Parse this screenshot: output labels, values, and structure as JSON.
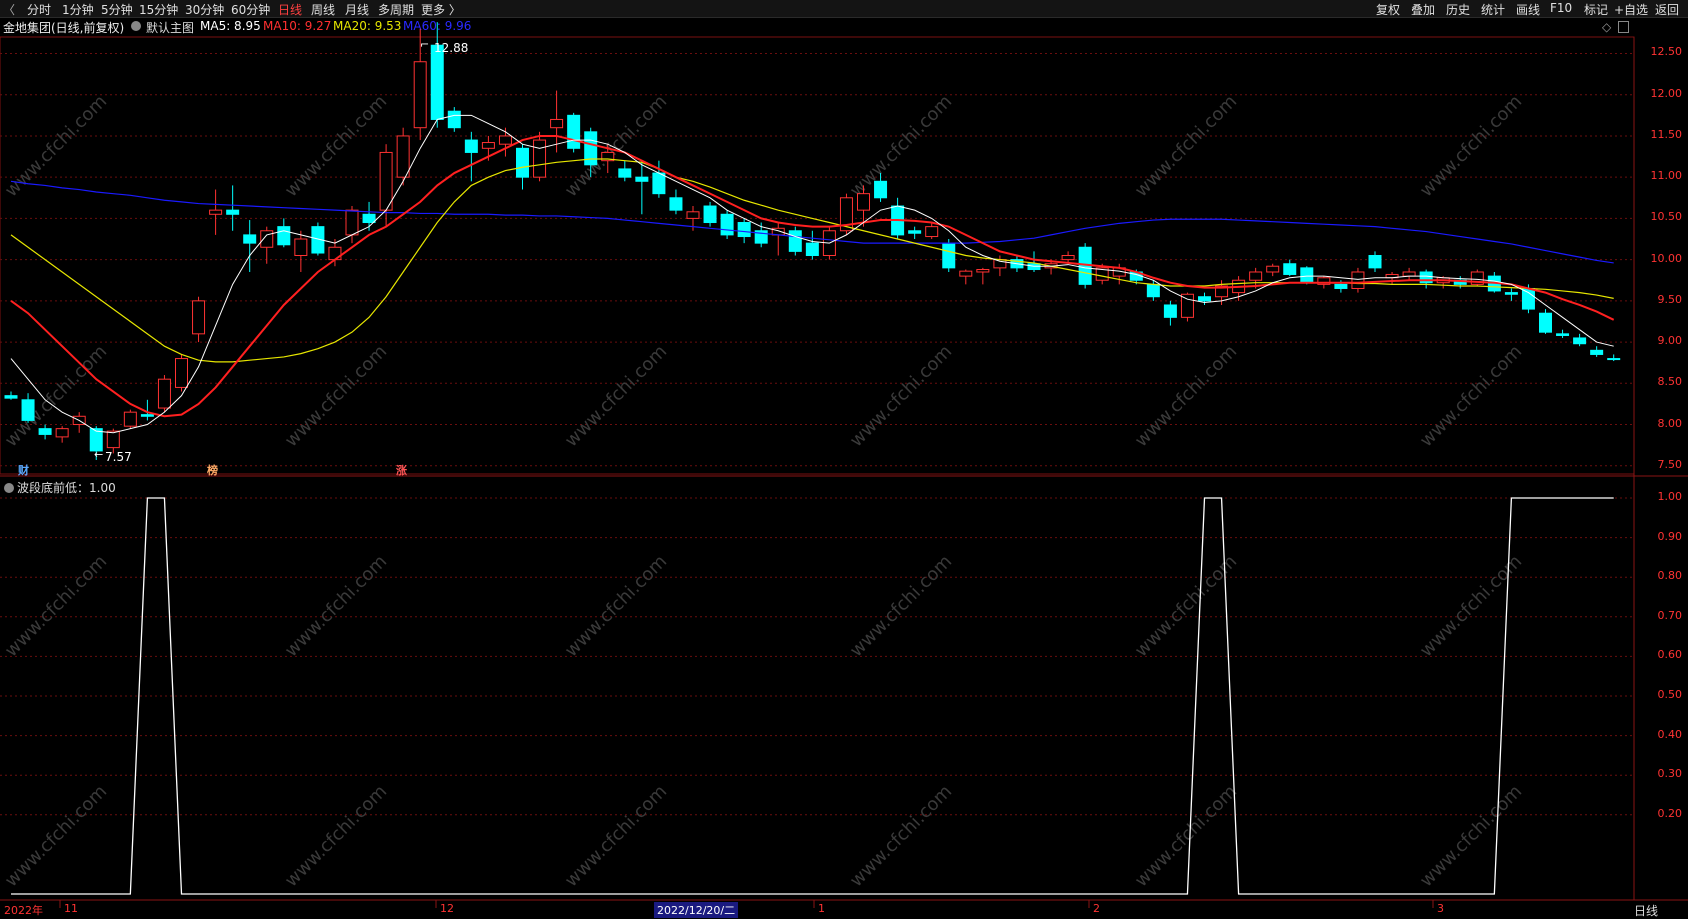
{
  "toolbar": {
    "left_items": [
      "分时",
      "1分钟",
      "5分钟",
      "15分钟",
      "30分钟",
      "60分钟",
      "日线",
      "周线",
      "月线",
      "多周期",
      "更多 〉"
    ],
    "active": "日线",
    "right_items": [
      "复权",
      "叠加",
      "历史",
      "统计",
      "画线",
      "F10",
      "标记",
      "+自选",
      "返回"
    ]
  },
  "info": {
    "stock": "金地集团(日线,前复权)",
    "template": "默认主图",
    "ma5": "MA5: 8.95",
    "ma10": "MA10: 9.27",
    "ma20": "MA20: 9.53",
    "ma60": "MA60: 9.96"
  },
  "main_ticks": [
    "12.50",
    "12.00",
    "11.50",
    "11.00",
    "10.50",
    "10.00",
    "9.50",
    "9.00",
    "8.50",
    "8.00",
    "7.50"
  ],
  "sub_ticks": [
    "1.00",
    "0.90",
    "0.80",
    "0.70",
    "0.60",
    "0.50",
    "0.40",
    "0.30",
    "0.20"
  ],
  "annotations": {
    "high": "12.88",
    "low": "7.57"
  },
  "signals": {
    "cai": "财",
    "bang": "榜",
    "zhang": "涨"
  },
  "sub_panel": {
    "label": "波段底前低：1.00"
  },
  "x_labels": [
    "2022年",
    "11",
    "12",
    "1",
    "2",
    "3"
  ],
  "cursor_date": "2022/12/20/二",
  "period_label": "日线",
  "watermark": "www.cfchi.com",
  "colors": {
    "up": "#ff3232",
    "down": "#00ffff",
    "ma5": "#ffffff",
    "ma10": "#ff2020",
    "ma20": "#e6e600",
    "ma60": "#1a1aff"
  },
  "chart_data": {
    "type": "candlestick",
    "ylim": [
      7.4,
      12.7
    ],
    "candles": [
      [
        8.35,
        8.4,
        8.3,
        8.32
      ],
      [
        8.3,
        8.38,
        8.02,
        8.05
      ],
      [
        7.95,
        8.0,
        7.82,
        7.88
      ],
      [
        7.85,
        7.98,
        7.78,
        7.95
      ],
      [
        8.0,
        8.15,
        7.9,
        8.1
      ],
      [
        7.95,
        7.98,
        7.57,
        7.68
      ],
      [
        7.72,
        7.95,
        7.65,
        7.92
      ],
      [
        7.98,
        8.18,
        7.95,
        8.15
      ],
      [
        8.12,
        8.3,
        8.05,
        8.1
      ],
      [
        8.2,
        8.6,
        8.15,
        8.55
      ],
      [
        8.45,
        8.85,
        8.4,
        8.8
      ],
      [
        9.1,
        9.55,
        9.0,
        9.5
      ],
      [
        10.55,
        10.85,
        10.3,
        10.6
      ],
      [
        10.6,
        10.9,
        10.35,
        10.55
      ],
      [
        10.3,
        10.48,
        9.85,
        10.2
      ],
      [
        10.15,
        10.4,
        9.95,
        10.35
      ],
      [
        10.4,
        10.5,
        10.15,
        10.18
      ],
      [
        10.05,
        10.35,
        9.85,
        10.25
      ],
      [
        10.4,
        10.45,
        10.05,
        10.08
      ],
      [
        10.0,
        10.25,
        9.92,
        10.15
      ],
      [
        10.3,
        10.65,
        10.2,
        10.6
      ],
      [
        10.55,
        10.7,
        10.35,
        10.45
      ],
      [
        10.6,
        11.4,
        10.4,
        11.3
      ],
      [
        11.0,
        11.6,
        10.9,
        11.5
      ],
      [
        11.6,
        12.8,
        11.45,
        12.4
      ],
      [
        12.6,
        12.88,
        11.6,
        11.7
      ],
      [
        11.8,
        11.85,
        11.55,
        11.6
      ],
      [
        11.45,
        11.55,
        10.95,
        11.3
      ],
      [
        11.35,
        11.5,
        11.2,
        11.42
      ],
      [
        11.4,
        11.6,
        11.25,
        11.5
      ],
      [
        11.35,
        11.4,
        10.85,
        11.0
      ],
      [
        11.0,
        11.55,
        10.95,
        11.45
      ],
      [
        11.6,
        12.05,
        11.3,
        11.7
      ],
      [
        11.75,
        11.78,
        11.3,
        11.35
      ],
      [
        11.55,
        11.6,
        11.0,
        11.15
      ],
      [
        11.2,
        11.4,
        11.05,
        11.3
      ],
      [
        11.1,
        11.2,
        10.95,
        11.0
      ],
      [
        11.0,
        11.2,
        10.55,
        10.95
      ],
      [
        11.05,
        11.2,
        10.75,
        10.8
      ],
      [
        10.75,
        10.85,
        10.55,
        10.6
      ],
      [
        10.5,
        10.65,
        10.35,
        10.58
      ],
      [
        10.65,
        10.7,
        10.4,
        10.45
      ],
      [
        10.55,
        10.6,
        10.25,
        10.3
      ],
      [
        10.45,
        10.5,
        10.2,
        10.28
      ],
      [
        10.35,
        10.45,
        10.15,
        10.2
      ],
      [
        10.3,
        10.45,
        10.05,
        10.38
      ],
      [
        10.35,
        10.4,
        10.05,
        10.1
      ],
      [
        10.2,
        10.35,
        10.0,
        10.05
      ],
      [
        10.05,
        10.4,
        10.0,
        10.35
      ],
      [
        10.35,
        10.8,
        10.3,
        10.75
      ],
      [
        10.6,
        10.9,
        10.4,
        10.8
      ],
      [
        10.95,
        11.05,
        10.7,
        10.75
      ],
      [
        10.65,
        10.75,
        10.25,
        10.3
      ],
      [
        10.35,
        10.4,
        10.25,
        10.32
      ],
      [
        10.28,
        10.45,
        10.25,
        10.4
      ],
      [
        10.2,
        10.25,
        9.85,
        9.9
      ],
      [
        9.8,
        9.88,
        9.7,
        9.86
      ],
      [
        9.85,
        9.9,
        9.7,
        9.88
      ],
      [
        9.9,
        10.05,
        9.8,
        10.0
      ],
      [
        10.0,
        10.05,
        9.85,
        9.9
      ],
      [
        9.95,
        10.1,
        9.85,
        9.88
      ],
      [
        9.9,
        10.0,
        9.82,
        9.95
      ],
      [
        10.0,
        10.1,
        9.95,
        10.05
      ],
      [
        10.15,
        10.2,
        9.65,
        9.7
      ],
      [
        9.75,
        9.95,
        9.7,
        9.9
      ],
      [
        9.8,
        9.95,
        9.7,
        9.9
      ],
      [
        9.85,
        9.88,
        9.7,
        9.75
      ],
      [
        9.7,
        9.75,
        9.5,
        9.55
      ],
      [
        9.45,
        9.5,
        9.2,
        9.3
      ],
      [
        9.3,
        9.6,
        9.25,
        9.58
      ],
      [
        9.55,
        9.6,
        9.45,
        9.5
      ],
      [
        9.55,
        9.75,
        9.45,
        9.68
      ],
      [
        9.6,
        9.8,
        9.5,
        9.75
      ],
      [
        9.75,
        9.9,
        9.65,
        9.85
      ],
      [
        9.85,
        9.95,
        9.8,
        9.92
      ],
      [
        9.95,
        10.0,
        9.8,
        9.82
      ],
      [
        9.9,
        9.92,
        9.7,
        9.72
      ],
      [
        9.7,
        9.8,
        9.65,
        9.78
      ],
      [
        9.7,
        9.75,
        9.6,
        9.65
      ],
      [
        9.65,
        9.9,
        9.6,
        9.85
      ],
      [
        10.05,
        10.1,
        9.85,
        9.9
      ],
      [
        9.78,
        9.85,
        9.7,
        9.82
      ],
      [
        9.8,
        9.9,
        9.75,
        9.85
      ],
      [
        9.85,
        9.88,
        9.65,
        9.72
      ],
      [
        9.72,
        9.8,
        9.65,
        9.78
      ],
      [
        9.75,
        9.8,
        9.65,
        9.7
      ],
      [
        9.7,
        9.88,
        9.68,
        9.85
      ],
      [
        9.8,
        9.85,
        9.6,
        9.62
      ],
      [
        9.6,
        9.65,
        9.5,
        9.58
      ],
      [
        9.65,
        9.7,
        9.35,
        9.4
      ],
      [
        9.35,
        9.4,
        9.1,
        9.12
      ],
      [
        9.1,
        9.15,
        9.05,
        9.08
      ],
      [
        9.05,
        9.1,
        8.95,
        8.98
      ],
      [
        8.9,
        8.95,
        8.82,
        8.85
      ],
      [
        8.8,
        8.85,
        8.77,
        8.79
      ]
    ],
    "ma5": [
      8.8,
      8.55,
      8.3,
      8.15,
      8.05,
      7.92,
      7.9,
      7.95,
      8.0,
      8.15,
      8.35,
      8.7,
      9.2,
      9.7,
      10.05,
      10.3,
      10.35,
      10.3,
      10.25,
      10.2,
      10.3,
      10.4,
      10.6,
      10.95,
      11.35,
      11.7,
      11.75,
      11.75,
      11.65,
      11.55,
      11.4,
      11.35,
      11.4,
      11.45,
      11.45,
      11.4,
      11.3,
      11.15,
      11.05,
      10.95,
      10.85,
      10.75,
      10.6,
      10.5,
      10.4,
      10.35,
      10.28,
      10.22,
      10.2,
      10.3,
      10.45,
      10.6,
      10.65,
      10.6,
      10.5,
      10.35,
      10.15,
      10.05,
      9.98,
      9.95,
      9.92,
      9.92,
      9.94,
      9.9,
      9.88,
      9.86,
      9.82,
      9.75,
      9.62,
      9.52,
      9.48,
      9.5,
      9.55,
      9.62,
      9.72,
      9.78,
      9.8,
      9.8,
      9.78,
      9.76,
      9.78,
      9.78,
      9.8,
      9.8,
      9.78,
      9.77,
      9.76,
      9.74,
      9.7,
      9.6,
      9.45,
      9.3,
      9.15,
      9.0,
      8.95
    ],
    "ma10": [
      9.5,
      9.35,
      9.15,
      8.95,
      8.75,
      8.55,
      8.4,
      8.25,
      8.15,
      8.1,
      8.12,
      8.25,
      8.45,
      8.7,
      8.95,
      9.2,
      9.45,
      9.65,
      9.85,
      10.0,
      10.15,
      10.3,
      10.4,
      10.55,
      10.7,
      10.9,
      11.05,
      11.15,
      11.25,
      11.35,
      11.45,
      11.5,
      11.5,
      11.45,
      11.4,
      11.35,
      11.3,
      11.2,
      11.1,
      11.0,
      10.9,
      10.8,
      10.7,
      10.6,
      10.5,
      10.45,
      10.42,
      10.4,
      10.4,
      10.42,
      10.45,
      10.48,
      10.48,
      10.47,
      10.45,
      10.4,
      10.3,
      10.2,
      10.1,
      10.05,
      10.0,
      9.98,
      9.96,
      9.94,
      9.92,
      9.9,
      9.85,
      9.78,
      9.72,
      9.68,
      9.66,
      9.66,
      9.67,
      9.68,
      9.7,
      9.72,
      9.72,
      9.72,
      9.72,
      9.72,
      9.73,
      9.74,
      9.75,
      9.75,
      9.75,
      9.74,
      9.73,
      9.72,
      9.7,
      9.65,
      9.6,
      9.52,
      9.45,
      9.37,
      9.27
    ],
    "ma20": [
      10.3,
      10.15,
      10.0,
      9.85,
      9.7,
      9.55,
      9.4,
      9.25,
      9.1,
      8.95,
      8.85,
      8.78,
      8.76,
      8.76,
      8.78,
      8.8,
      8.82,
      8.86,
      8.92,
      9.0,
      9.12,
      9.3,
      9.55,
      9.85,
      10.15,
      10.45,
      10.7,
      10.9,
      11.0,
      11.08,
      11.12,
      11.15,
      11.18,
      11.2,
      11.22,
      11.22,
      11.2,
      11.18,
      11.1,
      11.0,
      10.95,
      10.88,
      10.8,
      10.72,
      10.66,
      10.6,
      10.55,
      10.5,
      10.45,
      10.4,
      10.35,
      10.3,
      10.25,
      10.2,
      10.15,
      10.1,
      10.05,
      10.02,
      10.0,
      9.98,
      9.96,
      9.92,
      9.88,
      9.84,
      9.8,
      9.76,
      9.72,
      9.7,
      9.68,
      9.68,
      9.68,
      9.7,
      9.71,
      9.72,
      9.72,
      9.72,
      9.72,
      9.72,
      9.72,
      9.71,
      9.71,
      9.7,
      9.7,
      9.7,
      9.69,
      9.68,
      9.68,
      9.67,
      9.66,
      9.65,
      9.64,
      9.62,
      9.6,
      9.57,
      9.53
    ],
    "ma60": [
      10.95,
      10.92,
      10.9,
      10.87,
      10.85,
      10.82,
      10.8,
      10.78,
      10.75,
      10.72,
      10.7,
      10.68,
      10.67,
      10.66,
      10.65,
      10.64,
      10.63,
      10.62,
      10.61,
      10.6,
      10.59,
      10.58,
      10.57,
      10.57,
      10.56,
      10.56,
      10.55,
      10.55,
      10.55,
      10.54,
      10.54,
      10.53,
      10.53,
      10.52,
      10.51,
      10.5,
      10.48,
      10.46,
      10.44,
      10.42,
      10.4,
      10.38,
      10.36,
      10.34,
      10.32,
      10.3,
      10.28,
      10.26,
      10.24,
      10.22,
      10.2,
      10.2,
      10.2,
      10.2,
      10.2,
      10.2,
      10.2,
      10.21,
      10.22,
      10.24,
      10.26,
      10.3,
      10.34,
      10.38,
      10.41,
      10.44,
      10.46,
      10.48,
      10.49,
      10.49,
      10.49,
      10.49,
      10.48,
      10.47,
      10.46,
      10.45,
      10.44,
      10.43,
      10.42,
      10.41,
      10.4,
      10.38,
      10.36,
      10.34,
      10.31,
      10.28,
      10.25,
      10.22,
      10.19,
      10.15,
      10.11,
      10.07,
      10.03,
      9.99,
      9.96
    ],
    "indicator": [
      0,
      0,
      0,
      0,
      0,
      0,
      0,
      0,
      1,
      1,
      0,
      0,
      0,
      0,
      0,
      0,
      0,
      0,
      0,
      0,
      0,
      0,
      0,
      0,
      0,
      0,
      0,
      0,
      0,
      0,
      0,
      0,
      0,
      0,
      0,
      0,
      0,
      0,
      0,
      0,
      0,
      0,
      0,
      0,
      0,
      0,
      0,
      0,
      0,
      0,
      0,
      0,
      0,
      0,
      0,
      0,
      0,
      0,
      0,
      0,
      0,
      0,
      0,
      0,
      0,
      0,
      0,
      0,
      0,
      0,
      1,
      1,
      0,
      0,
      0,
      0,
      0,
      0,
      0,
      0,
      0,
      0,
      0,
      0,
      0,
      0,
      0,
      0,
      1,
      1,
      1,
      1,
      1,
      1,
      1
    ]
  }
}
